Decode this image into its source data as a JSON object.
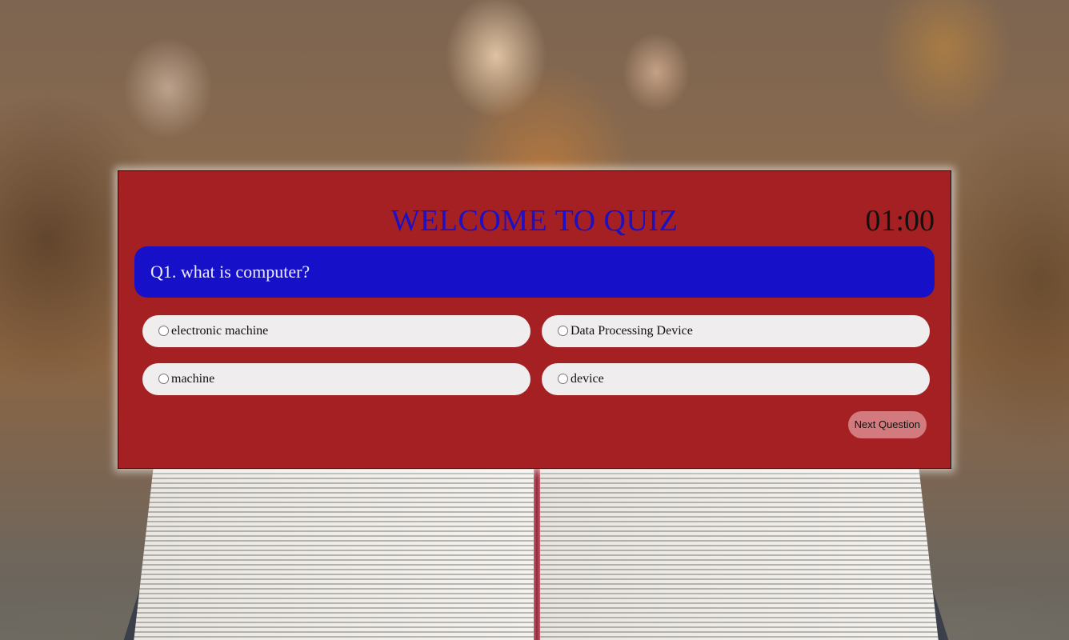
{
  "colors": {
    "panel_background": "#a42022",
    "title": "#1a10c8",
    "question_background": "#1710c9",
    "option_background": "#efedee",
    "next_button_background": "#d27a7d"
  },
  "quiz": {
    "title": "WELCOME TO QUIZ",
    "timer": "01:00",
    "question": "Q1. what is computer?",
    "options": [
      {
        "label": "electronic machine",
        "selected": false
      },
      {
        "label": "Data Processing Device",
        "selected": false
      },
      {
        "label": "machine",
        "selected": false
      },
      {
        "label": "device",
        "selected": false
      }
    ],
    "next_button_label": "Next Question"
  }
}
